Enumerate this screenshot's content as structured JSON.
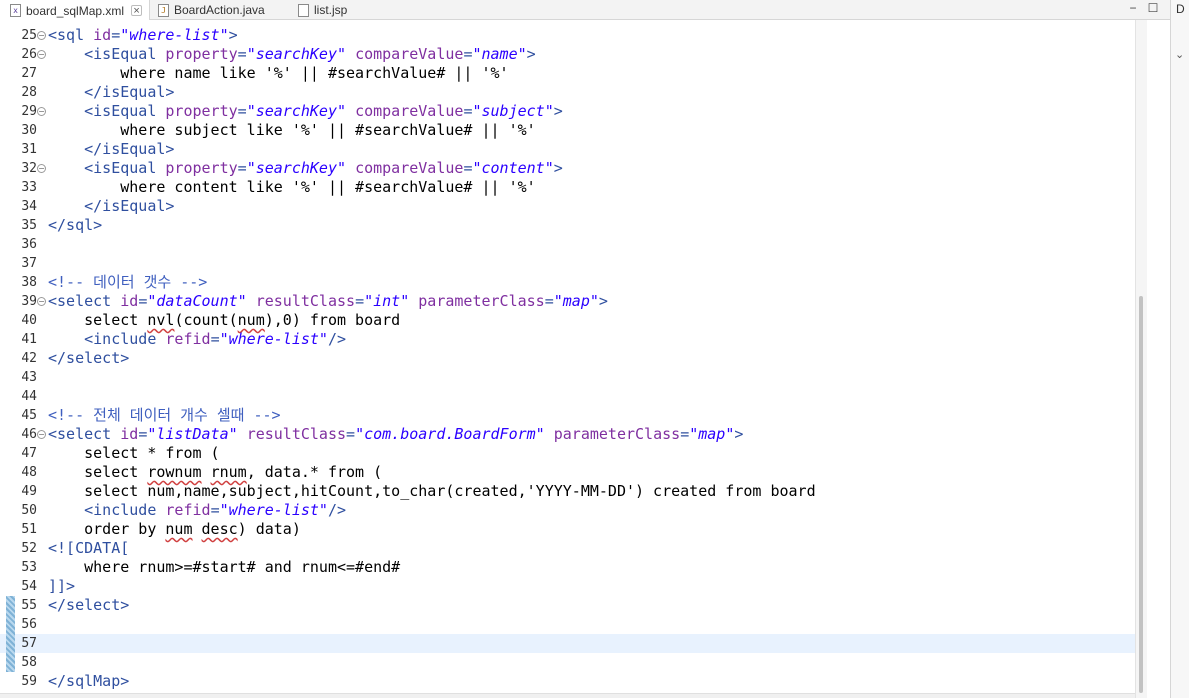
{
  "tabs": [
    {
      "label": "board_sqlMap.xml",
      "icon": "xml-file-icon",
      "glyph": "x",
      "active": true,
      "closable": true
    },
    {
      "label": "BoardAction.java",
      "icon": "java-file-icon",
      "glyph": "J",
      "active": false,
      "closable": false
    },
    {
      "label": "list.jsp",
      "icon": "jsp-file-icon",
      "glyph": "",
      "active": false,
      "closable": false
    }
  ],
  "window_controls": {
    "minimize": "−",
    "maximize": "☐"
  },
  "right_panel": {
    "label": "D",
    "chevron": "⌄"
  },
  "colors": {
    "tag": "#2f4f9f",
    "attribute": "#7f2fa0",
    "string": "#2a00ff",
    "comment": "#3f5fbf",
    "current_line": "#e8f2fe",
    "change_marker": "#7fb2d6"
  },
  "editor": {
    "current_line": 57,
    "changed_lines": [
      55,
      56,
      57,
      58
    ],
    "lines": [
      {
        "n": 25,
        "fold": true,
        "t": [
          [
            "tag",
            "<sql "
          ],
          [
            "attr",
            "id"
          ],
          [
            "tag",
            "="
          ],
          [
            "str",
            "\"where-list\""
          ],
          [
            "tag",
            ">"
          ]
        ]
      },
      {
        "n": 26,
        "fold": true,
        "t": [
          [
            "txt",
            "    "
          ],
          [
            "tag",
            "<isEqual "
          ],
          [
            "attr",
            "property"
          ],
          [
            "tag",
            "="
          ],
          [
            "str",
            "\"searchKey\""
          ],
          [
            "txt",
            " "
          ],
          [
            "attr",
            "compareValue"
          ],
          [
            "tag",
            "="
          ],
          [
            "str",
            "\"name\""
          ],
          [
            "tag",
            ">"
          ]
        ]
      },
      {
        "n": 27,
        "t": [
          [
            "txt",
            "        where name like '%' || #searchValue# || '%'"
          ]
        ]
      },
      {
        "n": 28,
        "t": [
          [
            "txt",
            "    "
          ],
          [
            "tag",
            "</isEqual>"
          ]
        ]
      },
      {
        "n": 29,
        "fold": true,
        "t": [
          [
            "txt",
            "    "
          ],
          [
            "tag",
            "<isEqual "
          ],
          [
            "attr",
            "property"
          ],
          [
            "tag",
            "="
          ],
          [
            "str",
            "\"searchKey\""
          ],
          [
            "txt",
            " "
          ],
          [
            "attr",
            "compareValue"
          ],
          [
            "tag",
            "="
          ],
          [
            "str",
            "\"subject\""
          ],
          [
            "tag",
            ">"
          ]
        ]
      },
      {
        "n": 30,
        "t": [
          [
            "txt",
            "        where subject like '%' || #searchValue# || '%'"
          ]
        ]
      },
      {
        "n": 31,
        "t": [
          [
            "txt",
            "    "
          ],
          [
            "tag",
            "</isEqual>"
          ]
        ]
      },
      {
        "n": 32,
        "fold": true,
        "t": [
          [
            "txt",
            "    "
          ],
          [
            "tag",
            "<isEqual "
          ],
          [
            "attr",
            "property"
          ],
          [
            "tag",
            "="
          ],
          [
            "str",
            "\"searchKey\""
          ],
          [
            "txt",
            " "
          ],
          [
            "attr",
            "compareValue"
          ],
          [
            "tag",
            "="
          ],
          [
            "str",
            "\"content\""
          ],
          [
            "tag",
            ">"
          ]
        ]
      },
      {
        "n": 33,
        "t": [
          [
            "txt",
            "        where content like '%' || #searchValue# || '%'"
          ]
        ]
      },
      {
        "n": 34,
        "t": [
          [
            "txt",
            "    "
          ],
          [
            "tag",
            "</isEqual>"
          ]
        ]
      },
      {
        "n": 35,
        "t": [
          [
            "tag",
            "</sql>"
          ]
        ]
      },
      {
        "n": 36,
        "t": []
      },
      {
        "n": 37,
        "t": []
      },
      {
        "n": 38,
        "t": [
          [
            "cmt",
            "<!-- 데이터 갯수 -->"
          ]
        ]
      },
      {
        "n": 39,
        "fold": true,
        "t": [
          [
            "tag",
            "<select "
          ],
          [
            "attr",
            "id"
          ],
          [
            "tag",
            "="
          ],
          [
            "str",
            "\"dataCount\""
          ],
          [
            "txt",
            " "
          ],
          [
            "attr",
            "resultClass"
          ],
          [
            "tag",
            "="
          ],
          [
            "str",
            "\"int\""
          ],
          [
            "txt",
            " "
          ],
          [
            "attr",
            "parameterClass"
          ],
          [
            "tag",
            "="
          ],
          [
            "str",
            "\"map\""
          ],
          [
            "tag",
            ">"
          ]
        ]
      },
      {
        "n": 40,
        "t": [
          [
            "txt",
            "    select "
          ],
          [
            "warn",
            "nvl"
          ],
          [
            "txt",
            "(count("
          ],
          [
            "warn",
            "num"
          ],
          [
            "txt",
            "),0) from board"
          ]
        ]
      },
      {
        "n": 41,
        "t": [
          [
            "txt",
            "    "
          ],
          [
            "tag",
            "<include "
          ],
          [
            "attr",
            "refid"
          ],
          [
            "tag",
            "="
          ],
          [
            "str",
            "\"where-list\""
          ],
          [
            "tag",
            "/>"
          ]
        ]
      },
      {
        "n": 42,
        "t": [
          [
            "tag",
            "</select>"
          ]
        ]
      },
      {
        "n": 43,
        "t": []
      },
      {
        "n": 44,
        "t": []
      },
      {
        "n": 45,
        "t": [
          [
            "cmt",
            "<!-- 전체 데이터 개수 셀때 -->"
          ]
        ]
      },
      {
        "n": 46,
        "fold": true,
        "t": [
          [
            "tag",
            "<select "
          ],
          [
            "attr",
            "id"
          ],
          [
            "tag",
            "="
          ],
          [
            "str",
            "\"listData\""
          ],
          [
            "txt",
            " "
          ],
          [
            "attr",
            "resultClass"
          ],
          [
            "tag",
            "="
          ],
          [
            "str",
            "\"com.board.BoardForm\""
          ],
          [
            "txt",
            " "
          ],
          [
            "attr",
            "parameterClass"
          ],
          [
            "tag",
            "="
          ],
          [
            "str",
            "\"map\""
          ],
          [
            "tag",
            ">"
          ]
        ]
      },
      {
        "n": 47,
        "t": [
          [
            "txt",
            "    select * from ("
          ]
        ]
      },
      {
        "n": 48,
        "t": [
          [
            "txt",
            "    select "
          ],
          [
            "warn",
            "rownum"
          ],
          [
            "txt",
            " "
          ],
          [
            "warn",
            "rnum"
          ],
          [
            "txt",
            ", data.* from ("
          ]
        ]
      },
      {
        "n": 49,
        "t": [
          [
            "txt",
            "    select num,name,subject,hitCount,to_char(created,'YYYY-MM-DD') created from board"
          ]
        ]
      },
      {
        "n": 50,
        "t": [
          [
            "txt",
            "    "
          ],
          [
            "tag",
            "<include "
          ],
          [
            "attr",
            "refid"
          ],
          [
            "tag",
            "="
          ],
          [
            "str",
            "\"where-list\""
          ],
          [
            "tag",
            "/>"
          ]
        ]
      },
      {
        "n": 51,
        "t": [
          [
            "txt",
            "    order by "
          ],
          [
            "warn",
            "num"
          ],
          [
            "txt",
            " "
          ],
          [
            "warn",
            "desc"
          ],
          [
            "txt",
            ") data)"
          ]
        ]
      },
      {
        "n": 52,
        "t": [
          [
            "tag",
            "<![CDATA["
          ]
        ]
      },
      {
        "n": 53,
        "t": [
          [
            "txt",
            "    where rnum>=#start# and rnum<=#end#"
          ]
        ]
      },
      {
        "n": 54,
        "t": [
          [
            "tag",
            "]]>"
          ]
        ]
      },
      {
        "n": 55,
        "t": [
          [
            "tag",
            "</select>"
          ]
        ]
      },
      {
        "n": 56,
        "t": []
      },
      {
        "n": 57,
        "t": []
      },
      {
        "n": 58,
        "t": []
      },
      {
        "n": 59,
        "t": [
          [
            "tag",
            "</sqlMap>"
          ]
        ]
      }
    ]
  }
}
